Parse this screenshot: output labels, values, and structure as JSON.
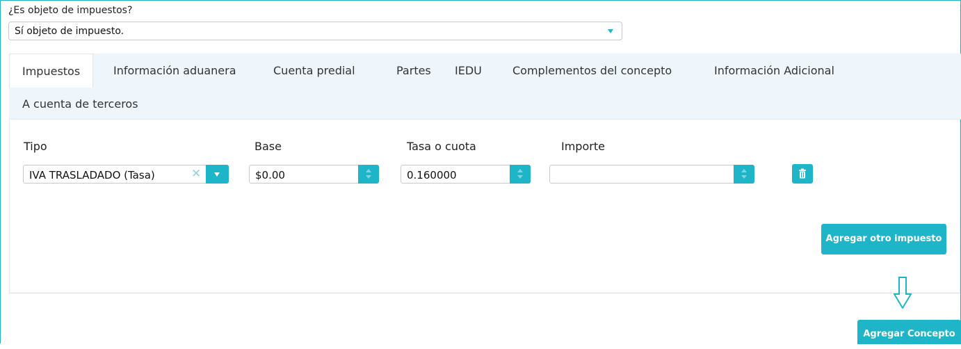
{
  "objeto": {
    "question": "¿Es objeto de impuestos?",
    "selected": "Sí objeto de impuesto."
  },
  "tabs": [
    {
      "label": "Impuestos",
      "active": true
    },
    {
      "label": "Información aduanera"
    },
    {
      "label": "Cuenta predial"
    },
    {
      "label": "Partes"
    },
    {
      "label": "IEDU"
    },
    {
      "label": "Complementos del concepto"
    },
    {
      "label": "Información Adicional"
    }
  ],
  "subtab": "A cuenta de terceros",
  "impuestos": {
    "headers": {
      "tipo": "Tipo",
      "base": "Base",
      "tasa": "Tasa o cuota",
      "importe": "Importe"
    },
    "row": {
      "tipo": "IVA TRASLADADO (Tasa)",
      "base": "$0.00",
      "tasa": "0.160000",
      "importe": ""
    }
  },
  "buttons": {
    "agregar_impuesto": "Agregar otro impuesto",
    "agregar_concepto": "Agregar Concepto"
  },
  "colors": {
    "accent": "#1fb5c8",
    "tab_bg": "#eef6fb"
  },
  "icons": {
    "trash": "trash-icon",
    "clear": "clear-x-icon",
    "dropdown": "chevron-down-icon",
    "hint_arrow": "arrow-down-icon"
  }
}
